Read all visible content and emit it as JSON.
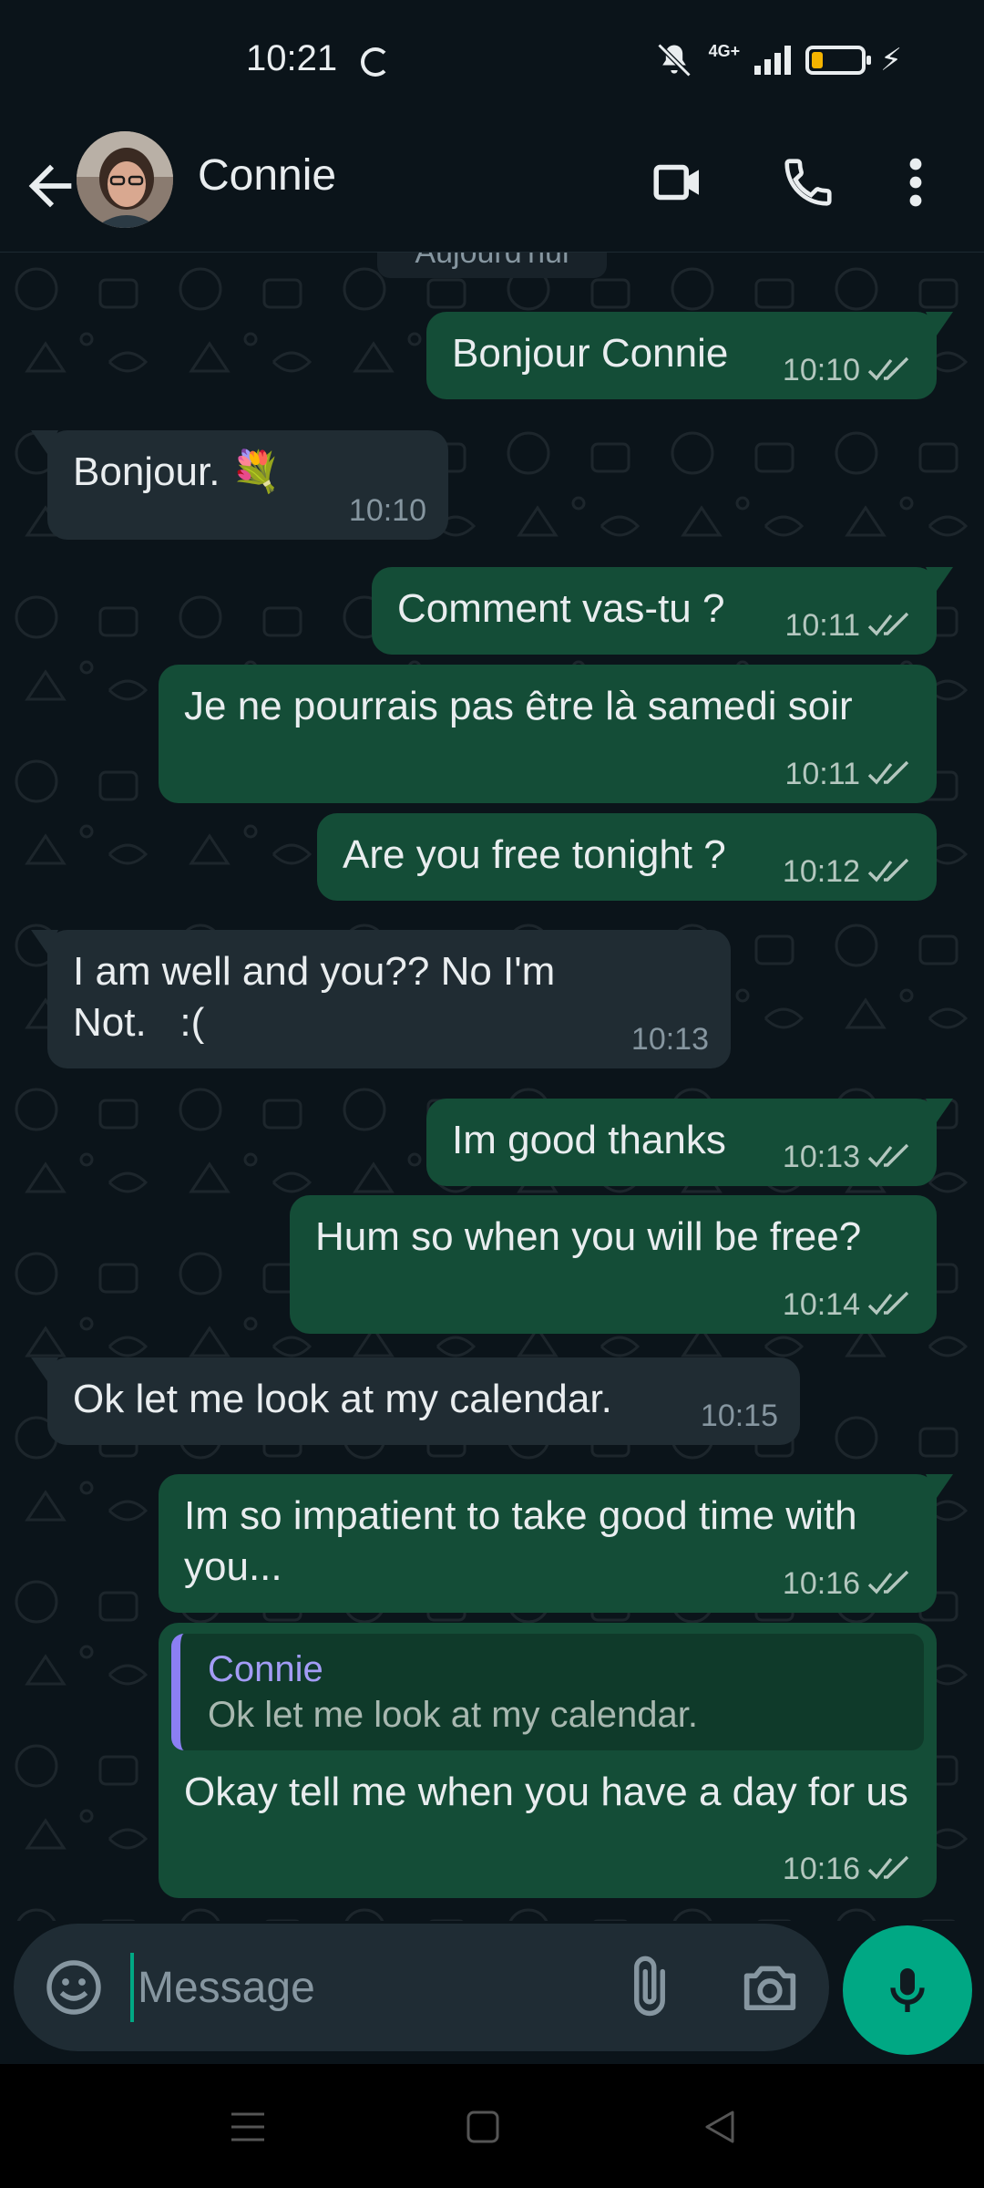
{
  "status_bar": {
    "time": "10:21",
    "network": "4G+"
  },
  "header": {
    "contact_name": "Connie"
  },
  "chat": {
    "date_chip": "Aujourd'hui",
    "messages": [
      {
        "dir": "out",
        "text": "Bonjour Connie",
        "time": "10:10"
      },
      {
        "dir": "in",
        "text": "Bonjour. 💐",
        "time": "10:10"
      },
      {
        "dir": "out",
        "text": "Comment vas-tu ?",
        "time": "10:11"
      },
      {
        "dir": "out",
        "text": "Je ne pourrais pas être là samedi soir",
        "time": "10:11"
      },
      {
        "dir": "out",
        "text": "Are you free tonight ?",
        "time": "10:12"
      },
      {
        "dir": "in",
        "text": "I am well and you?? No I'm Not.   :(",
        "time": "10:13"
      },
      {
        "dir": "out",
        "text": "Im good thanks",
        "time": "10:13"
      },
      {
        "dir": "out",
        "text": "Hum so when you will be free?",
        "time": "10:14"
      },
      {
        "dir": "in",
        "text": "Ok let me look at my calendar.",
        "time": "10:15"
      },
      {
        "dir": "out",
        "text": "Im so impatient to take good time with you...",
        "time": "10:16"
      },
      {
        "dir": "out",
        "text": "Okay tell me when you have a day for us",
        "time": "10:16",
        "quote": {
          "name": "Connie",
          "text": "Ok let me look at my calendar."
        }
      }
    ]
  },
  "input": {
    "placeholder": "Message"
  },
  "colors": {
    "outgoing_bubble": "#144d37",
    "incoming_bubble": "#202c33",
    "accent": "#00a884",
    "background": "#0b141a"
  }
}
